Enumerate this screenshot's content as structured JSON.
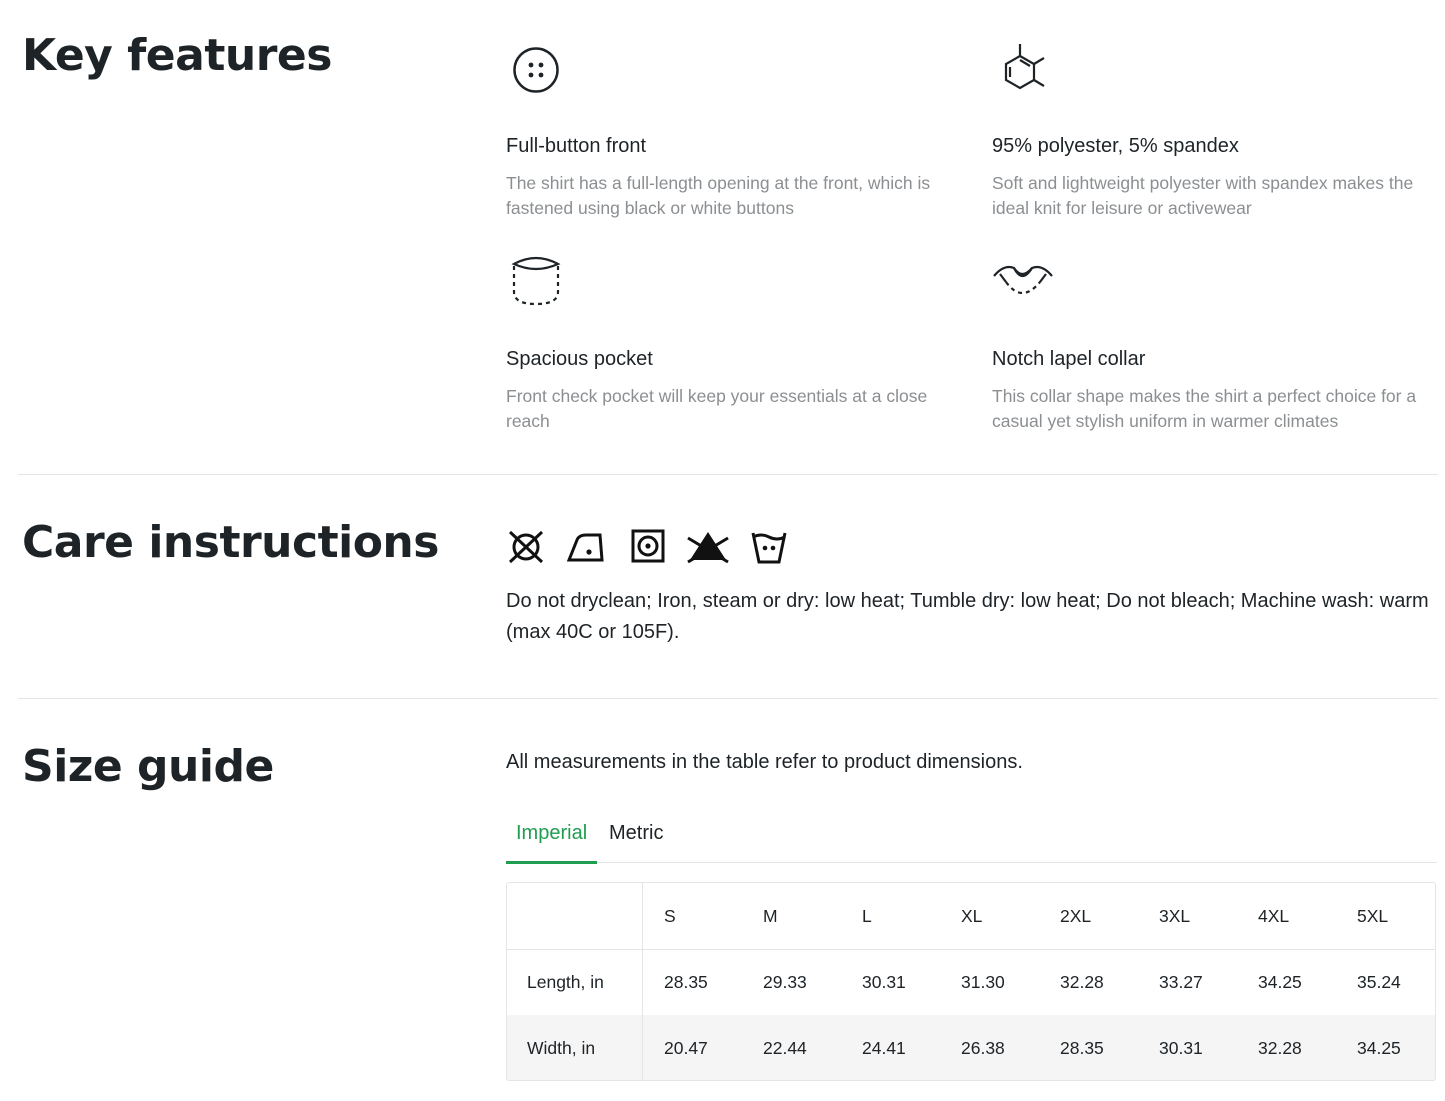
{
  "sections": {
    "key_features": {
      "title": "Key features",
      "items": [
        {
          "icon": "buttons-icon",
          "title": "Full-button front",
          "desc": "The shirt has a full-length opening at the front, which is fastened using black or white buttons"
        },
        {
          "icon": "polyester-molecule-icon",
          "title": "95% polyester, 5% spandex",
          "desc": "Soft and lightweight polyester with spandex makes the ideal knit for leisure or activewear"
        },
        {
          "icon": "pocket-icon",
          "title": "Spacious pocket",
          "desc": "Front check pocket will keep your essentials at a close reach"
        },
        {
          "icon": "collar-icon",
          "title": "Notch lapel collar",
          "desc": "This collar shape makes the shirt a perfect choice for a casual yet stylish uniform in warmer climates"
        }
      ]
    },
    "care": {
      "title": "Care instructions",
      "icons": [
        "do-not-dryclean-icon",
        "iron-low-heat-icon",
        "tumble-dry-low-icon",
        "do-not-bleach-icon",
        "machine-wash-warm-icon"
      ],
      "text": "Do not dryclean; Iron, steam or dry: low heat; Tumble dry: low heat; Do not bleach; Machine wash: warm (max 40C or 105F)."
    },
    "size_guide": {
      "title": "Size guide",
      "note": "All measurements in the table refer to product dimensions.",
      "tabs": [
        {
          "label": "Imperial",
          "active": true
        },
        {
          "label": "Metric",
          "active": false
        }
      ],
      "sizes": [
        "S",
        "M",
        "L",
        "XL",
        "2XL",
        "3XL",
        "4XL",
        "5XL"
      ],
      "rows": [
        {
          "label": "Length, in",
          "values": [
            "28.35",
            "29.33",
            "30.31",
            "31.30",
            "32.28",
            "33.27",
            "34.25",
            "35.24"
          ]
        },
        {
          "label": "Width, in",
          "values": [
            "20.47",
            "22.44",
            "24.41",
            "26.38",
            "28.35",
            "30.31",
            "32.28",
            "34.25"
          ]
        }
      ]
    }
  },
  "colors": {
    "accent": "#1f9d50",
    "text": "#1d2327",
    "muted": "#8b8f92",
    "border": "#e3e5e6",
    "stripe": "#f5f5f5"
  }
}
